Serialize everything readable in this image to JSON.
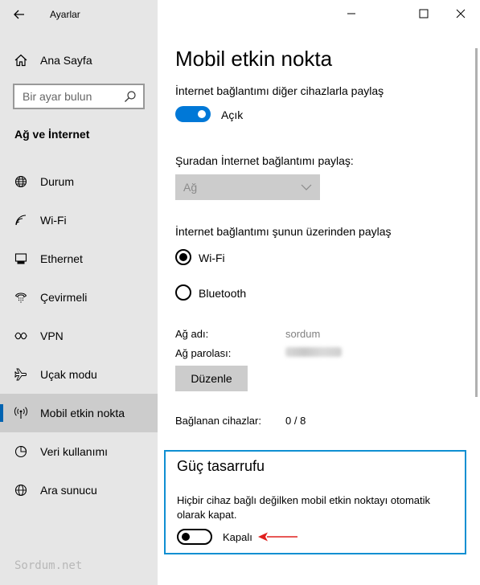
{
  "window": {
    "title": "Ayarlar"
  },
  "sidebar": {
    "home_label": "Ana Sayfa",
    "search_placeholder": "Bir ayar bulun",
    "section_title": "Ağ ve İnternet",
    "items": [
      {
        "label": "Durum",
        "icon": "globe-icon"
      },
      {
        "label": "Wi-Fi",
        "icon": "wifi-icon"
      },
      {
        "label": "Ethernet",
        "icon": "ethernet-icon"
      },
      {
        "label": "Çevirmeli",
        "icon": "dialup-icon"
      },
      {
        "label": "VPN",
        "icon": "vpn-icon"
      },
      {
        "label": "Uçak modu",
        "icon": "airplane-icon"
      },
      {
        "label": "Mobil etkin nokta",
        "icon": "hotspot-icon",
        "selected": true
      },
      {
        "label": "Veri kullanımı",
        "icon": "data-usage-icon"
      },
      {
        "label": "Ara sunucu",
        "icon": "proxy-icon"
      }
    ]
  },
  "main": {
    "title": "Mobil etkin nokta",
    "share_label": "İnternet bağlantımı diğer cihazlarla paylaş",
    "share_toggle": {
      "state": "on",
      "label": "Açık"
    },
    "share_from_label": "Şuradan İnternet bağlantımı paylaş:",
    "share_from_value": "Ağ",
    "share_over_label": "İnternet bağlantımı şunun üzerinden paylaş",
    "radio_options": [
      {
        "label": "Wi-Fi",
        "selected": true
      },
      {
        "label": "Bluetooth",
        "selected": false
      }
    ],
    "network_name_label": "Ağ adı:",
    "network_name_value": "sordum",
    "network_password_label": "Ağ parolası:",
    "edit_button": "Düzenle",
    "connected_label": "Bağlanan cihazlar:",
    "connected_value": "0 / 8"
  },
  "power_saving": {
    "title": "Güç tasarrufu",
    "description": "Hiçbir cihaz bağlı değilken mobil etkin noktayı otomatik olarak kapat.",
    "toggle": {
      "state": "off",
      "label": "Kapalı"
    }
  },
  "watermark": "Sordum.net",
  "colors": {
    "accent": "#0078d7",
    "selection_bar": "#0063b1",
    "highlight_border": "#0f8fd2",
    "arrow": "#e0201e"
  }
}
